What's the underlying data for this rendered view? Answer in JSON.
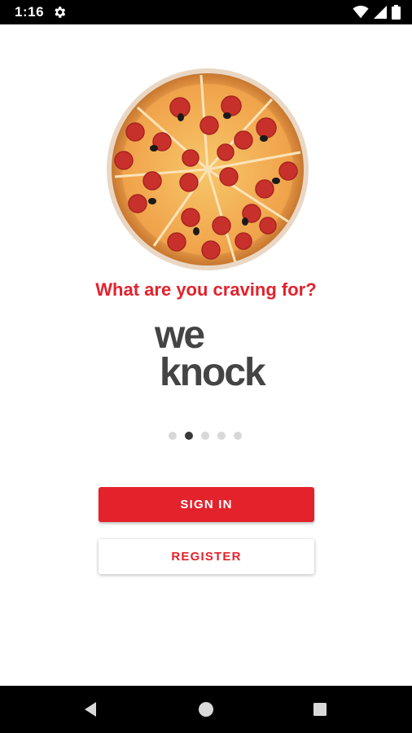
{
  "status_bar": {
    "time": "1:16",
    "icons": [
      "gear-icon",
      "wifi-icon",
      "signal-icon",
      "battery-icon"
    ]
  },
  "hero": {
    "image": "pizza-image",
    "tagline": "What are you craving for?"
  },
  "logo": {
    "line1": "we",
    "line2": "knock"
  },
  "pager": {
    "count": 5,
    "active_index": 1
  },
  "buttons": {
    "sign_in": "SIGN IN",
    "register": "REGISTER"
  },
  "colors": {
    "accent": "#e3222c",
    "logo": "#444444",
    "dot_active": "#3a3a3a",
    "dot_inactive": "#d8d8d8"
  },
  "nav_bar": {
    "icons": [
      "back-icon",
      "home-icon",
      "recents-icon"
    ]
  }
}
